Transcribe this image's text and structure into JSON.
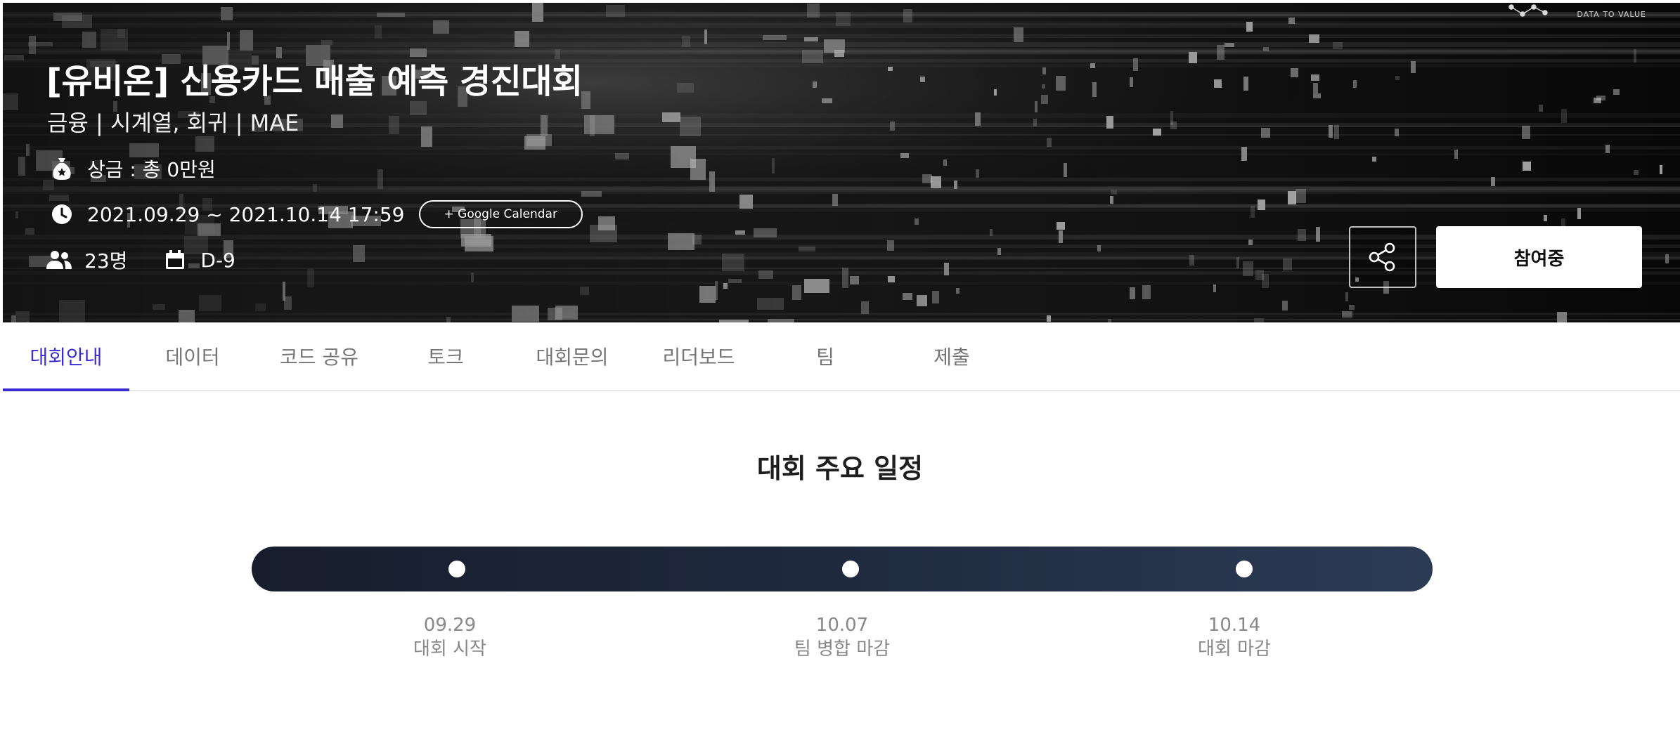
{
  "hero": {
    "logo_tagline": "DATA TO VALUE",
    "title": "[유비온] 신용카드 매출 예측 경진대회",
    "subtitle": "금융 | 시계열, 회귀 | MAE",
    "prize": "상금 : 총 0만원",
    "date_range": "2021.09.29 ~ 2021.10.14 17:59",
    "google_calendar_label": "+ Google Calendar",
    "participants": "23명",
    "dday": "D-9",
    "join_label": "참여중",
    "icons": [
      "money-bag-icon",
      "clock-icon",
      "people-icon",
      "calendar-icon",
      "share-icon"
    ]
  },
  "tabs": [
    {
      "label": "대회안내",
      "active": true
    },
    {
      "label": "데이터",
      "active": false
    },
    {
      "label": "코드 공유",
      "active": false
    },
    {
      "label": "토크",
      "active": false
    },
    {
      "label": "대회문의",
      "active": false
    },
    {
      "label": "리더보드",
      "active": false
    },
    {
      "label": "팀",
      "active": false
    },
    {
      "label": "제출",
      "active": false
    }
  ],
  "schedule": {
    "title": "대회 주요 일정",
    "milestones": [
      {
        "date": "09.29",
        "label": "대회 시작"
      },
      {
        "date": "10.07",
        "label": "팀 병합 마감"
      },
      {
        "date": "10.14",
        "label": "대회 마감"
      }
    ]
  },
  "colors": {
    "accent": "#3b2bd4",
    "timeline_start": "#171d2c",
    "timeline_end": "#2c3b55",
    "hero_bg": "#0b0b0b"
  }
}
